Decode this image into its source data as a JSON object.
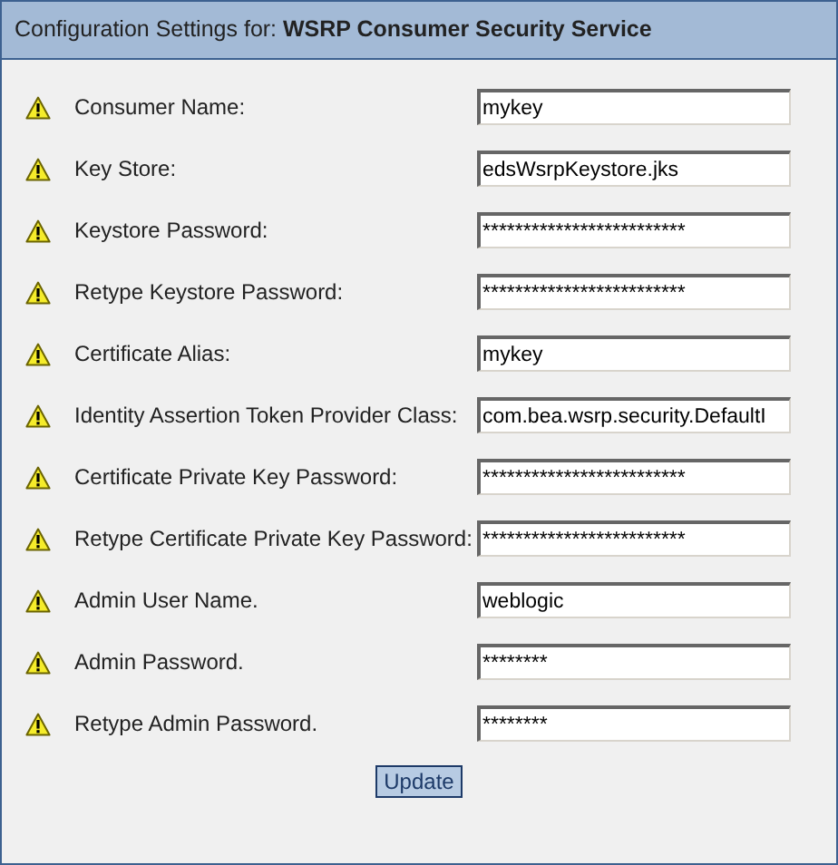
{
  "header": {
    "title": "Configuration Settings for: **WSRP Consumer Security Service**"
  },
  "fields": [
    {
      "label": "Consumer Name:",
      "value": "mykey"
    },
    {
      "label": "Key Store:",
      "value": "edsWsrpKeystore.jks"
    },
    {
      "label": "Keystore Password:",
      "value": "*************************"
    },
    {
      "label": "Retype Keystore Password:",
      "value": "*************************"
    },
    {
      "label": "Certificate Alias:",
      "value": "mykey"
    },
    {
      "label": "Identity Assertion Token Provider Class:",
      "value": "com.bea.wsrp.security.DefaultI"
    },
    {
      "label": "Certificate Private Key Password:",
      "value": "*************************"
    },
    {
      "label": "Retype Certificate Private Key Password:",
      "value": "*************************"
    },
    {
      "label": "Admin User Name.",
      "value": "weblogic"
    },
    {
      "label": "Admin Password.",
      "value": "********"
    },
    {
      "label": "Retype Admin Password.",
      "value": "********"
    }
  ],
  "button": {
    "label": "Update"
  }
}
